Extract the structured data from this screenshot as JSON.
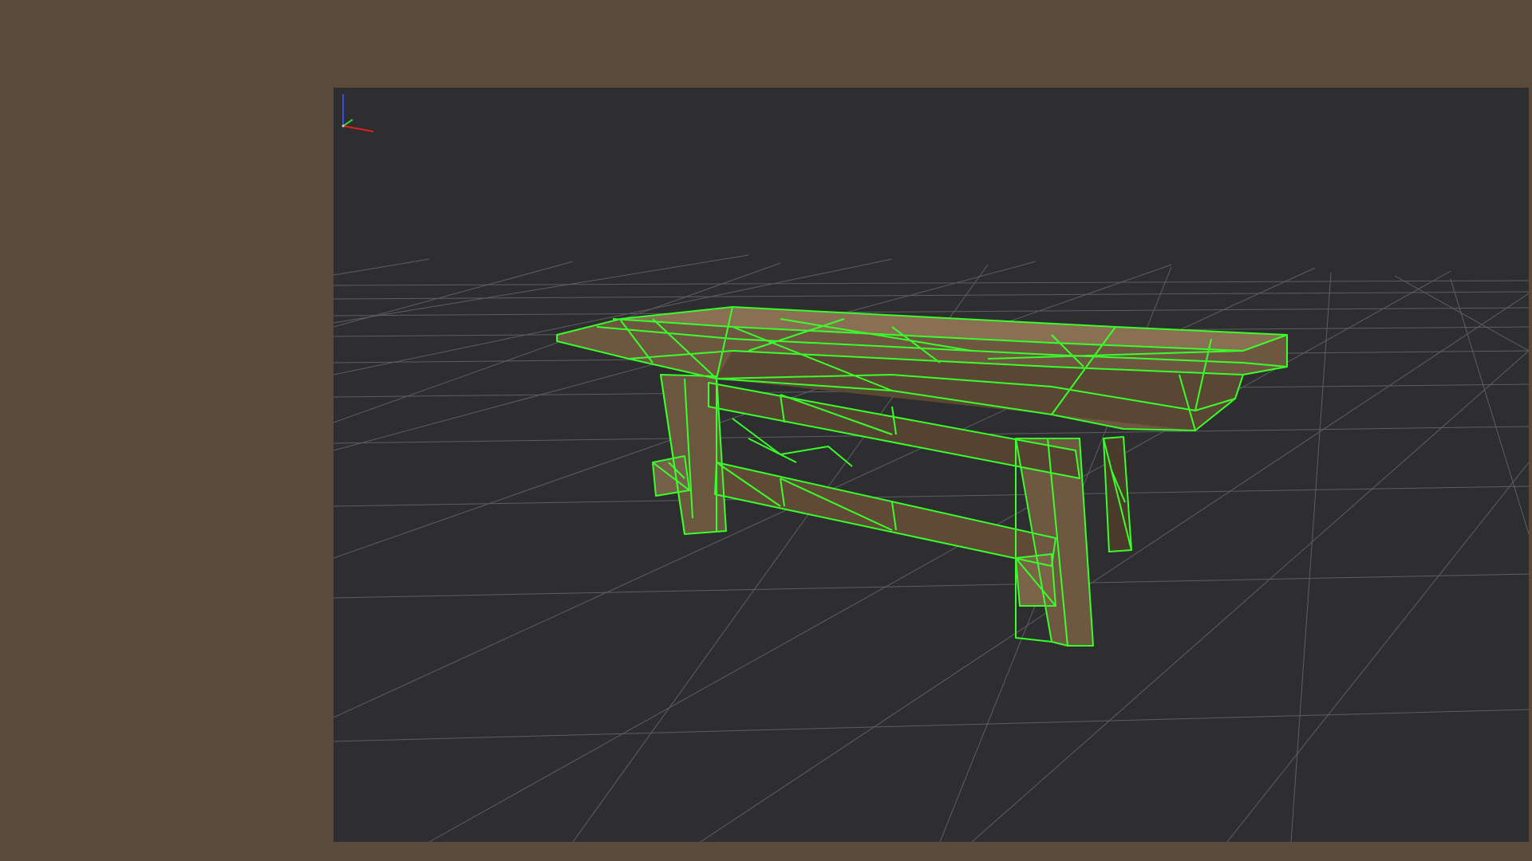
{
  "colors": {
    "background": "#5a4a3a",
    "viewport": "#2e2d30",
    "grid": "#6f6f73",
    "wireframe": "#39ff2a",
    "wood_light": "#7a6347",
    "wood_mid": "#5e4a35",
    "wood_dark": "#3f3224",
    "axis_x": "#e02020",
    "axis_y": "#3ad12e",
    "axis_z": "#2e4fe0"
  },
  "viewport": {
    "mode": "wireframe-on-shaded",
    "model": "wooden-bench",
    "grid": true
  },
  "gizmo": {
    "icon": "axis-gizmo-icon"
  }
}
